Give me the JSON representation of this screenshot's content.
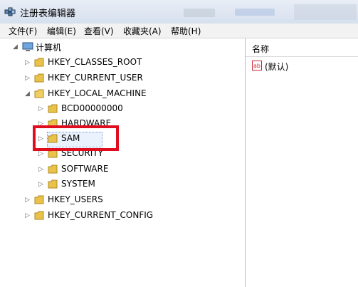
{
  "window": {
    "title": "注册表编辑器"
  },
  "menu": [
    "文件(F)",
    "编辑(E)",
    "查看(V)",
    "收藏夹(A)",
    "帮助(H)"
  ],
  "tree": {
    "root": "计算机",
    "nodes": [
      "HKEY_CLASSES_ROOT",
      "HKEY_CURRENT_USER",
      "HKEY_LOCAL_MACHINE",
      "BCD00000000",
      "HARDWARE",
      "SAM",
      "SECURITY",
      "SOFTWARE",
      "SYSTEM",
      "HKEY_USERS",
      "HKEY_CURRENT_CONFIG"
    ],
    "selected": "SAM"
  },
  "list": {
    "column_header": "名称",
    "rows": [
      {
        "name": "(默认)",
        "icon": "string-value-icon"
      }
    ]
  },
  "colors": {
    "highlight": "#e00d1e",
    "folder": "#e8c24a",
    "titlebar": "#dce5f1"
  }
}
